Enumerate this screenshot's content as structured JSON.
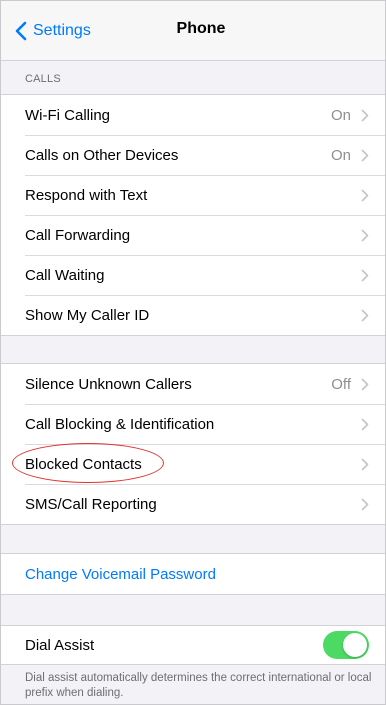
{
  "nav": {
    "back_label": "Settings",
    "title": "Phone"
  },
  "sections": {
    "calls_header": "CALLS"
  },
  "group1": [
    {
      "label": "Wi-Fi Calling",
      "value": "On"
    },
    {
      "label": "Calls on Other Devices",
      "value": "On"
    },
    {
      "label": "Respond with Text",
      "value": ""
    },
    {
      "label": "Call Forwarding",
      "value": ""
    },
    {
      "label": "Call Waiting",
      "value": ""
    },
    {
      "label": "Show My Caller ID",
      "value": ""
    }
  ],
  "group2": [
    {
      "label": "Silence Unknown Callers",
      "value": "Off"
    },
    {
      "label": "Call Blocking & Identification",
      "value": ""
    },
    {
      "label": "Blocked Contacts",
      "value": ""
    },
    {
      "label": "SMS/Call Reporting",
      "value": ""
    }
  ],
  "voicemail": {
    "label": "Change Voicemail Password"
  },
  "dial_assist": {
    "label": "Dial Assist",
    "enabled": true,
    "footnote": "Dial assist automatically determines the correct international or local prefix when dialing."
  },
  "colors": {
    "accent": "#007aff",
    "toggle_on": "#4cd964",
    "annotation": "#e0332e"
  },
  "icons": {
    "back": "chevron-left-icon",
    "disclosure": "chevron-right-icon"
  }
}
